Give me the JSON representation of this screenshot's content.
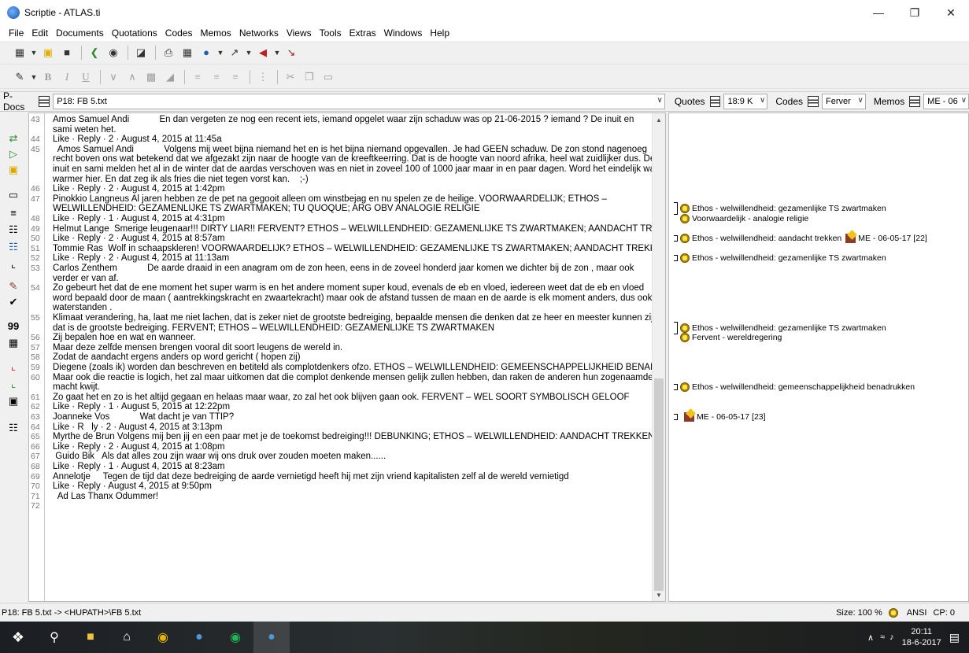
{
  "window": {
    "title": "Scriptie - ATLAS.ti"
  },
  "menu": [
    "File",
    "Edit",
    "Documents",
    "Quotations",
    "Codes",
    "Memos",
    "Networks",
    "Views",
    "Tools",
    "Extras",
    "Windows",
    "Help"
  ],
  "docbar": {
    "pdocs_label": "P-Docs",
    "pdoc_value": "P18: FB 5.txt",
    "quotes_label": "Quotes",
    "quotes_value": "18:9 K",
    "codes_label": "Codes",
    "codes_value": "Ferver",
    "memos_label": "Memos",
    "memos_value": "ME - 06"
  },
  "lines": [
    {
      "n": "43",
      "t": "Amos Samuel Andi            En dan vergeten ze nog een recent iets, iemand opgelet waar zijn schaduw was op 21-06-2015 ? iemand ? De inuit en"
    },
    {
      "n": "",
      "t": "sami weten het."
    },
    {
      "n": "44",
      "t": "Like · Reply · 2 · August 4, 2015 at 11:45a"
    },
    {
      "n": "45",
      "t": "  Amos Samuel Andi            Volgens mij weet bijna niemand het en is het bijna niemand opgevallen. Je had GEEN schaduw. De zon stond nagenoeg"
    },
    {
      "n": "",
      "t": "recht boven ons wat betekend dat we afgezakt zijn naar de hoogte van de kreeftkeerring. Dat is de hoogte van noord afrika, heel wat zuidlijker dus. De"
    },
    {
      "n": "",
      "t": "inuit en sami melden het al in de winter dat de aardas verschoven was en niet in zoveel 100 of 1000 jaar maar in en paar dagen. Word het eindelijk wat"
    },
    {
      "n": "",
      "t": "warmer hier. En dat zeg ik als fries die niet tegen vorst kan.    ;-)"
    },
    {
      "n": "46",
      "t": "Like · Reply · 2 · August 4, 2015 at 1:42pm"
    },
    {
      "n": "47",
      "t": "Pinokkio Langneus Al jaren hebben ze de pet na gegooit alleen om winstbejag en nu spelen ze de heilige. VOORWAARDELIJK; ETHOS –"
    },
    {
      "n": "",
      "t": "WELWILLENDHEID: GEZAMENLIJKE TS ZWARTMAKEN; TU QUOQUE; ARG OBV ANALOGIE RELIGIE"
    },
    {
      "n": "48",
      "t": "Like · Reply · 1 · August 4, 2015 at 4:31pm"
    },
    {
      "n": "49",
      "t": "Helmut Lange  Smerige leugenaar!!! DIRTY LIAR!! FERVENT? ETHOS – WELWILLENDHEID: GEZAMENLIJKE TS ZWARTMAKEN; AANDACHT TREKKEN"
    },
    {
      "n": "50",
      "t": "Like · Reply · 2 · August 4, 2015 at 8:57am"
    },
    {
      "n": "51",
      "t": "Tommie Ras  Wolf in schaapskleren! VOORWAARDELIJK? ETHOS – WELWILLENDHEID: GEZAMENLIJKE TS ZWARTMAKEN; AANDACHT TREKKEN"
    },
    {
      "n": "52",
      "t": "Like · Reply · 2 · August 4, 2015 at 11:13am"
    },
    {
      "n": "53",
      "t": "Carlos Zenthem            De aarde draaid in een anagram om de zon heen, eens in de zoveel honderd jaar komen we dichter bij de zon , maar ook"
    },
    {
      "n": "",
      "t": "verder er van af."
    },
    {
      "n": "54",
      "t": "Zo gebeurt het dat de ene moment het super warm is en het andere moment super koud, evenals de eb en vloed, iedereen weet dat de eb en vloed"
    },
    {
      "n": "",
      "t": "word bepaald door de maan ( aantrekkingskracht en zwaartekracht) maar ook de afstand tussen de maan en de aarde is elk moment anders, dus ook de"
    },
    {
      "n": "",
      "t": "waterstanden ."
    },
    {
      "n": "55",
      "t": "Klimaat verandering, ha, laat me niet lachen, dat is zeker niet de grootste bedreiging, bepaalde mensen die denken dat ze heer en meester kunnen zijn,"
    },
    {
      "n": "",
      "t": "dat is de grootste bedreiging. FERVENT; ETHOS – WELWILLENDHEID: GEZAMENLIJKE TS ZWARTMAKEN"
    },
    {
      "n": "56",
      "t": "Zij bepalen hoe en wat en wanneer."
    },
    {
      "n": "57",
      "t": "Maar deze zelfde mensen brengen vooral dit soort leugens de wereld in."
    },
    {
      "n": "58",
      "t": "Zodat de aandacht ergens anders op word gericht ( hopen zij)"
    },
    {
      "n": "59",
      "t": "Diegene (zoals ik) worden dan beschreven en betiteld als complotdenkers ofzo. ETHOS – WELWILLENDHEID: GEMEENSCHAPPELIJKHEID BENADRUKKEN"
    },
    {
      "n": "60",
      "t": "Maar ook die reactie is logich, het zal maar uitkomen dat die complot denkende mensen gelijk zullen hebben, dan raken de anderen hun zogenaamde"
    },
    {
      "n": "",
      "t": "macht kwijt."
    },
    {
      "n": "61",
      "t": "Zo gaat het en zo is het altijd gegaan en helaas maar waar, zo zal het ook blijven gaan ook. FERVENT – WEL SOORT SYMBOLISCH GELOOF"
    },
    {
      "n": "62",
      "t": "Like · Reply · 1 · August 5, 2015 at 12:22pm"
    },
    {
      "n": "63",
      "t": "Joanneke Vos            Wat dacht je van TTIP?"
    },
    {
      "n": "64",
      "t": "Like · R   ly · 2 · August 4, 2015 at 3:13pm"
    },
    {
      "n": "65",
      "t": "Myrthe de Brun Volgens mij ben jij en een paar met je de toekomst bedreiging!!! DEBUNKING; ETHOS – WELWILLENDHEID: AANDACHT TREKKEN"
    },
    {
      "n": "66",
      "t": "Like · Reply · 2 · August 4, 2015 at 1:08pm"
    },
    {
      "n": "67",
      "t": " Guido Bik   Als dat alles zou zijn waar wij ons druk over zouden moeten maken......"
    },
    {
      "n": "68",
      "t": "Like · Reply · 1 · August 4, 2015 at 8:23am"
    },
    {
      "n": "69",
      "t": "Annelotje     Tegen de tijd dat deze bedreiging de aarde vernietigd heeft hij met zijn vriend kapitalisten zelf al de wereld vernietigd"
    },
    {
      "n": "70",
      "t": "Like · Reply · August 4, 2015 at 9:50pm"
    },
    {
      "n": "71",
      "t": "  Ad Las Thanx Odummer!"
    },
    {
      "n": "72",
      "t": ""
    }
  ],
  "margin": [
    {
      "row": 9,
      "bracket": 2,
      "items": [
        {
          "k": "code",
          "t": "Ethos - welwillendheid: gezamenlijke TS zwartmaken"
        }
      ]
    },
    {
      "row": 10,
      "bracket": 0,
      "items": [
        {
          "k": "code",
          "t": "Voorwaardelijk - analogie religie"
        }
      ]
    },
    {
      "row": 12,
      "bracket": 1,
      "items": [
        {
          "k": "code",
          "t": "Ethos - welwillendheid: aandacht trekken"
        },
        {
          "k": "memo",
          "t": "ME - 06-05-17 [22]"
        }
      ]
    },
    {
      "row": 14,
      "bracket": 1,
      "items": [
        {
          "k": "code",
          "t": "Ethos - welwillendheid: gezamenlijke TS zwartmaken"
        }
      ]
    },
    {
      "row": 21,
      "bracket": 2,
      "items": [
        {
          "k": "code",
          "t": "Ethos - welwillendheid: gezamenlijke TS zwartmaken"
        }
      ]
    },
    {
      "row": 22,
      "bracket": 0,
      "items": [
        {
          "k": "code",
          "t": "Fervent - wereldregering"
        }
      ]
    },
    {
      "row": 27,
      "bracket": 1,
      "items": [
        {
          "k": "code",
          "t": "Ethos - welwillendheid: gemeenschappelijkheid benadrukken"
        }
      ]
    },
    {
      "row": 30,
      "bracket": 1,
      "items": [
        {
          "k": "memo",
          "t": "ME - 06-05-17 [23]"
        }
      ]
    }
  ],
  "status": {
    "path": "P18: FB 5.txt -> <HUPATH>\\FB 5.txt",
    "size": "Size: 100 %",
    "encoding": "ANSI",
    "cp": "CP: 0"
  },
  "clock": {
    "time": "20:11",
    "date": "18-6-2017"
  }
}
